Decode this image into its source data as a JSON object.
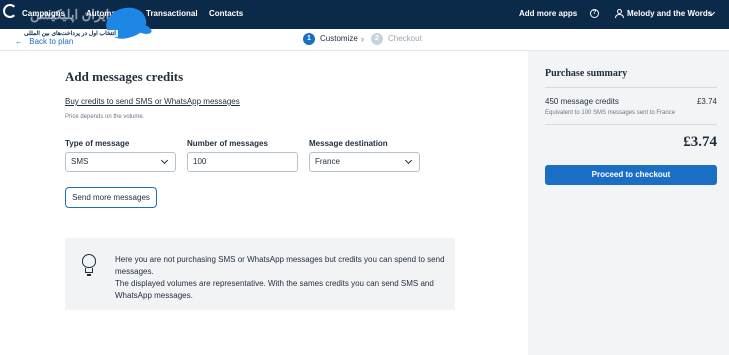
{
  "nav": {
    "items": [
      "Campaigns",
      "Automations",
      "Transactional",
      "Contacts"
    ],
    "add_apps": "Add more apps",
    "help_glyph": "?",
    "account_name": "Melody and the Words"
  },
  "watermark": {
    "text": "انتخاب اول در پرداخت‌های بین المللی",
    "big_text": "ایران اپلیکیشن"
  },
  "stepper": {
    "back_label": "Back to plan",
    "steps": [
      {
        "number": "1",
        "label": "Customize",
        "state": "active"
      },
      {
        "number": "2",
        "label": "Checkout",
        "state": "inactive"
      }
    ]
  },
  "main": {
    "title": "Add messages credits",
    "intro_link": "Buy credits to send SMS or WhatsApp messages",
    "intro_note": "Price depends on the volume.",
    "fields": [
      {
        "label": "Type of message",
        "value": "SMS",
        "kind": "select"
      },
      {
        "label": "Number of messages",
        "value": "100",
        "kind": "input"
      },
      {
        "label": "Message destination",
        "value": "France",
        "kind": "select"
      }
    ],
    "send_more_label": "Send more messages"
  },
  "info": {
    "lines": [
      "Here you are not purchasing SMS or WhatsApp messages but credits you can spend to send messages.",
      "The displayed volumes are representative. With the sames credits you can send SMS and WhatsApp messages."
    ]
  },
  "summary": {
    "title": "Purchase summary",
    "item_label": "450 message credits",
    "item_price": "£3.74",
    "item_note": "Equivalent to 100 SMS messages sent to France",
    "total": "£3.74",
    "checkout_label": "Proceed to checkout"
  },
  "colors": {
    "nav_bg": "#0b2a4a",
    "accent": "#1a6fc4",
    "panel_bg": "#f3f4f6",
    "info_bg": "#f2f3f5"
  },
  "icons": [
    "brand-logo-icon",
    "back-arrow-icon",
    "chevron-right-icon",
    "help-icon",
    "user-icon",
    "chevron-down-icon",
    "lightbulb-icon"
  ]
}
